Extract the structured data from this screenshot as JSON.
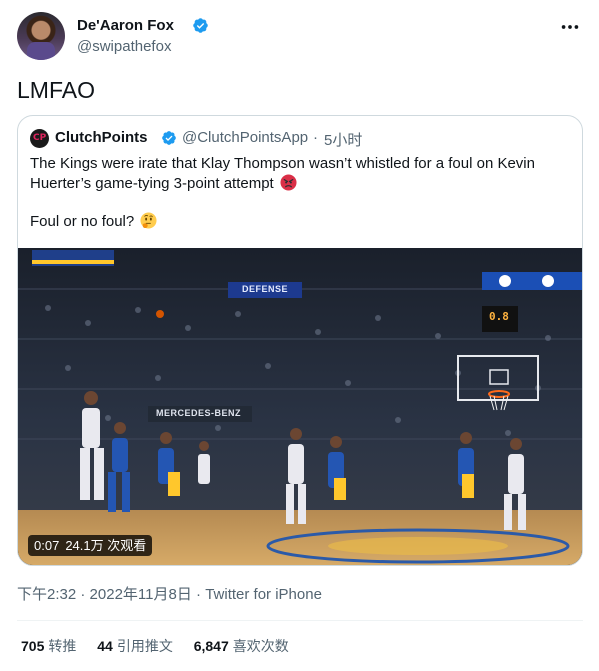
{
  "author": {
    "display_name": "De'Aaron Fox",
    "handle": "@swipathefox",
    "verified": true,
    "avatar_icon": "avatar"
  },
  "tweet": {
    "text": "LMFAO"
  },
  "quoted_tweet": {
    "display_name": "ClutchPoints",
    "logo_text": "CP",
    "handle": "@ClutchPointsApp",
    "dot": "·",
    "time": "5小时",
    "text": "The Kings were irate that Klay Thompson wasn’t whistled for a foul on Kevin Huerter’s game-tying 3-point attempt",
    "emoji_1": "angry-face-icon",
    "text_2": "Foul or no foul?",
    "emoji_2": "thinking-face-icon",
    "media": {
      "duration": "0:07",
      "views": "24.1万 次观看",
      "arena_sign_1": "DEFENSE",
      "arena_sign_2": "MERCEDES-BENZ",
      "shot_clock": "0.8"
    }
  },
  "meta": {
    "time": "下午2:32",
    "sep1": " · ",
    "date": "2022年11月8日",
    "sep2": " · ",
    "source": "Twitter for iPhone"
  },
  "stats": {
    "retweets_count": "705",
    "retweets_label": "转推",
    "quotes_count": "44",
    "quotes_label": "引用推文",
    "likes_count": "6,847",
    "likes_label": "喜欢次数"
  },
  "colors": {
    "verified_blue": "#1d9bf0",
    "text_primary": "#0f1419",
    "text_secondary": "#536471",
    "border": "#cfd9de"
  }
}
